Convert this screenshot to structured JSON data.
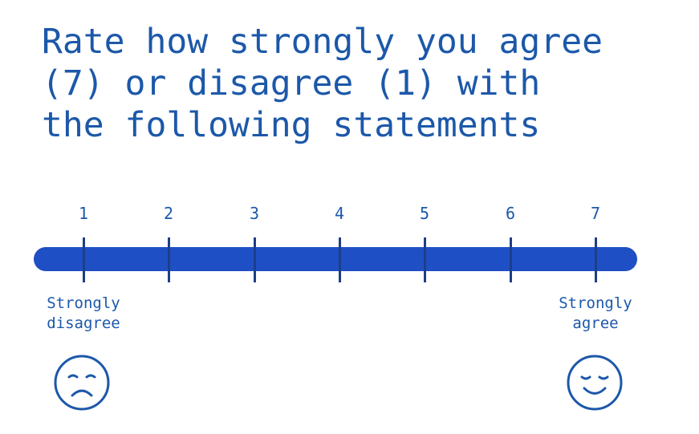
{
  "heading": {
    "lines": [
      "Rate how strongly you agree",
      "(7) or disagree (1) with",
      "the following statements"
    ]
  },
  "scale": {
    "points": [
      "1",
      "2",
      "3",
      "4",
      "5",
      "6",
      "7"
    ],
    "min_label": [
      "Strongly",
      "disagree"
    ],
    "max_label": [
      "Strongly",
      "agree"
    ],
    "min_icon": "sad-face-icon",
    "max_icon": "happy-face-icon"
  },
  "colors": {
    "text": "#1c58a9",
    "bar": "#1f4fc4",
    "tick": "#1c3f86"
  }
}
